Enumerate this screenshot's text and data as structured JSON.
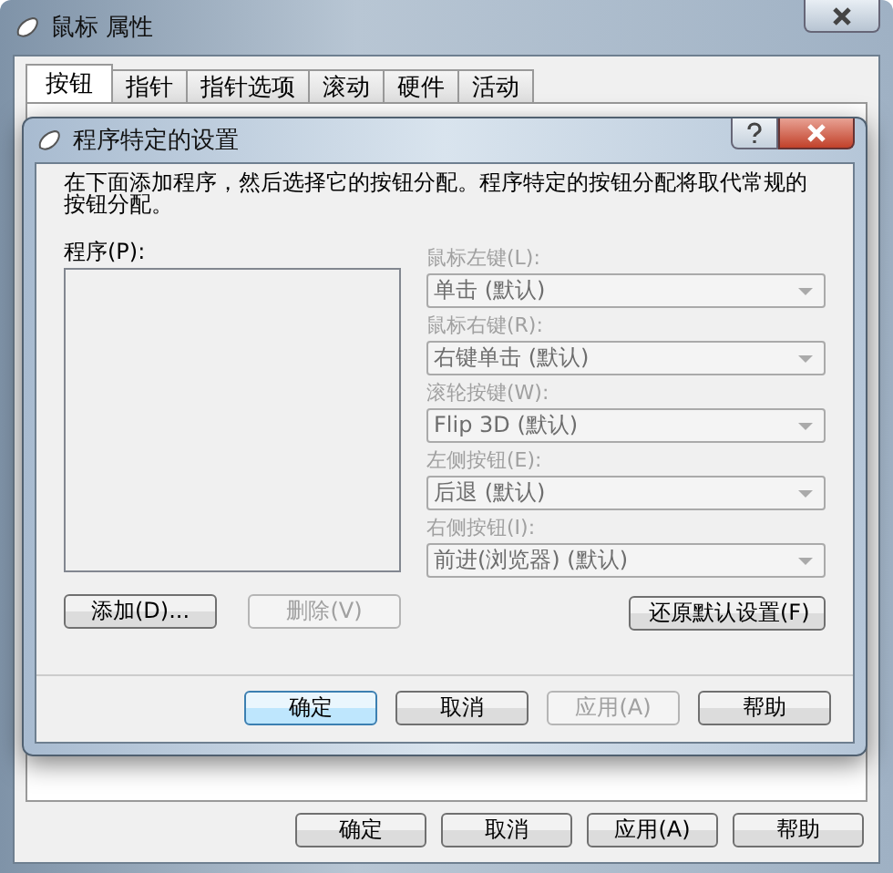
{
  "window": {
    "title": "鼠标 属性"
  },
  "tabs": [
    {
      "label": "按钮",
      "selected": true
    },
    {
      "label": "指针",
      "selected": false
    },
    {
      "label": "指针选项",
      "selected": false
    },
    {
      "label": "滚动",
      "selected": false
    },
    {
      "label": "硬件",
      "selected": false
    },
    {
      "label": "活动",
      "selected": false
    }
  ],
  "dialog": {
    "title": "程序特定的设置",
    "description": "在下面添加程序，然后选择它的按钮分配。程序特定的按钮分配将取代常规的按钮分配。",
    "programs_label": "程序(P):",
    "assignments": [
      {
        "label": "鼠标左键(L):",
        "value": "单击 (默认)",
        "disabled": true
      },
      {
        "label": "鼠标右键(R):",
        "value": "右键单击 (默认)",
        "disabled": true
      },
      {
        "label": "滚轮按键(W):",
        "value": "Flip 3D (默认)",
        "disabled": true
      },
      {
        "label": "左侧按钮(E):",
        "value": "后退 (默认)",
        "disabled": true
      },
      {
        "label": "右侧按钮(I):",
        "value": "前进(浏览器) (默认)",
        "disabled": true
      }
    ],
    "add_button": {
      "label": "添加(D)...",
      "disabled": false
    },
    "remove_button": {
      "label": "删除(V)",
      "disabled": true
    },
    "restore_button": {
      "label": "还原默认设置(F)",
      "disabled": false
    },
    "buttons": [
      {
        "label": "确定",
        "disabled": false,
        "default": true
      },
      {
        "label": "取消",
        "disabled": false,
        "default": false
      },
      {
        "label": "应用(A)",
        "disabled": true,
        "default": false
      },
      {
        "label": "帮助",
        "disabled": false,
        "default": false
      }
    ]
  },
  "buttons": [
    {
      "label": "确定",
      "disabled": false
    },
    {
      "label": "取消",
      "disabled": false
    },
    {
      "label": "应用(A)",
      "disabled": false
    },
    {
      "label": "帮助",
      "disabled": false
    }
  ]
}
